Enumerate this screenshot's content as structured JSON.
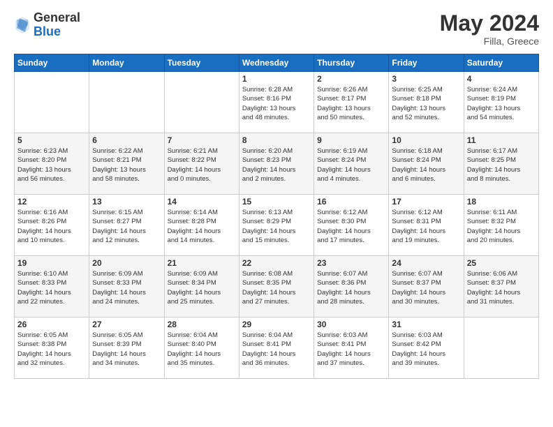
{
  "header": {
    "logo_general": "General",
    "logo_blue": "Blue",
    "title": "May 2024",
    "subtitle": "Filla, Greece"
  },
  "days_of_week": [
    "Sunday",
    "Monday",
    "Tuesday",
    "Wednesday",
    "Thursday",
    "Friday",
    "Saturday"
  ],
  "weeks": [
    [
      {
        "day": "",
        "content": ""
      },
      {
        "day": "",
        "content": ""
      },
      {
        "day": "",
        "content": ""
      },
      {
        "day": "1",
        "content": "Sunrise: 6:28 AM\nSunset: 8:16 PM\nDaylight: 13 hours\nand 48 minutes."
      },
      {
        "day": "2",
        "content": "Sunrise: 6:26 AM\nSunset: 8:17 PM\nDaylight: 13 hours\nand 50 minutes."
      },
      {
        "day": "3",
        "content": "Sunrise: 6:25 AM\nSunset: 8:18 PM\nDaylight: 13 hours\nand 52 minutes."
      },
      {
        "day": "4",
        "content": "Sunrise: 6:24 AM\nSunset: 8:19 PM\nDaylight: 13 hours\nand 54 minutes."
      }
    ],
    [
      {
        "day": "5",
        "content": "Sunrise: 6:23 AM\nSunset: 8:20 PM\nDaylight: 13 hours\nand 56 minutes."
      },
      {
        "day": "6",
        "content": "Sunrise: 6:22 AM\nSunset: 8:21 PM\nDaylight: 13 hours\nand 58 minutes."
      },
      {
        "day": "7",
        "content": "Sunrise: 6:21 AM\nSunset: 8:22 PM\nDaylight: 14 hours\nand 0 minutes."
      },
      {
        "day": "8",
        "content": "Sunrise: 6:20 AM\nSunset: 8:23 PM\nDaylight: 14 hours\nand 2 minutes."
      },
      {
        "day": "9",
        "content": "Sunrise: 6:19 AM\nSunset: 8:24 PM\nDaylight: 14 hours\nand 4 minutes."
      },
      {
        "day": "10",
        "content": "Sunrise: 6:18 AM\nSunset: 8:24 PM\nDaylight: 14 hours\nand 6 minutes."
      },
      {
        "day": "11",
        "content": "Sunrise: 6:17 AM\nSunset: 8:25 PM\nDaylight: 14 hours\nand 8 minutes."
      }
    ],
    [
      {
        "day": "12",
        "content": "Sunrise: 6:16 AM\nSunset: 8:26 PM\nDaylight: 14 hours\nand 10 minutes."
      },
      {
        "day": "13",
        "content": "Sunrise: 6:15 AM\nSunset: 8:27 PM\nDaylight: 14 hours\nand 12 minutes."
      },
      {
        "day": "14",
        "content": "Sunrise: 6:14 AM\nSunset: 8:28 PM\nDaylight: 14 hours\nand 14 minutes."
      },
      {
        "day": "15",
        "content": "Sunrise: 6:13 AM\nSunset: 8:29 PM\nDaylight: 14 hours\nand 15 minutes."
      },
      {
        "day": "16",
        "content": "Sunrise: 6:12 AM\nSunset: 8:30 PM\nDaylight: 14 hours\nand 17 minutes."
      },
      {
        "day": "17",
        "content": "Sunrise: 6:12 AM\nSunset: 8:31 PM\nDaylight: 14 hours\nand 19 minutes."
      },
      {
        "day": "18",
        "content": "Sunrise: 6:11 AM\nSunset: 8:32 PM\nDaylight: 14 hours\nand 20 minutes."
      }
    ],
    [
      {
        "day": "19",
        "content": "Sunrise: 6:10 AM\nSunset: 8:33 PM\nDaylight: 14 hours\nand 22 minutes."
      },
      {
        "day": "20",
        "content": "Sunrise: 6:09 AM\nSunset: 8:33 PM\nDaylight: 14 hours\nand 24 minutes."
      },
      {
        "day": "21",
        "content": "Sunrise: 6:09 AM\nSunset: 8:34 PM\nDaylight: 14 hours\nand 25 minutes."
      },
      {
        "day": "22",
        "content": "Sunrise: 6:08 AM\nSunset: 8:35 PM\nDaylight: 14 hours\nand 27 minutes."
      },
      {
        "day": "23",
        "content": "Sunrise: 6:07 AM\nSunset: 8:36 PM\nDaylight: 14 hours\nand 28 minutes."
      },
      {
        "day": "24",
        "content": "Sunrise: 6:07 AM\nSunset: 8:37 PM\nDaylight: 14 hours\nand 30 minutes."
      },
      {
        "day": "25",
        "content": "Sunrise: 6:06 AM\nSunset: 8:37 PM\nDaylight: 14 hours\nand 31 minutes."
      }
    ],
    [
      {
        "day": "26",
        "content": "Sunrise: 6:05 AM\nSunset: 8:38 PM\nDaylight: 14 hours\nand 32 minutes."
      },
      {
        "day": "27",
        "content": "Sunrise: 6:05 AM\nSunset: 8:39 PM\nDaylight: 14 hours\nand 34 minutes."
      },
      {
        "day": "28",
        "content": "Sunrise: 6:04 AM\nSunset: 8:40 PM\nDaylight: 14 hours\nand 35 minutes."
      },
      {
        "day": "29",
        "content": "Sunrise: 6:04 AM\nSunset: 8:41 PM\nDaylight: 14 hours\nand 36 minutes."
      },
      {
        "day": "30",
        "content": "Sunrise: 6:03 AM\nSunset: 8:41 PM\nDaylight: 14 hours\nand 37 minutes."
      },
      {
        "day": "31",
        "content": "Sunrise: 6:03 AM\nSunset: 8:42 PM\nDaylight: 14 hours\nand 39 minutes."
      },
      {
        "day": "",
        "content": ""
      }
    ]
  ]
}
